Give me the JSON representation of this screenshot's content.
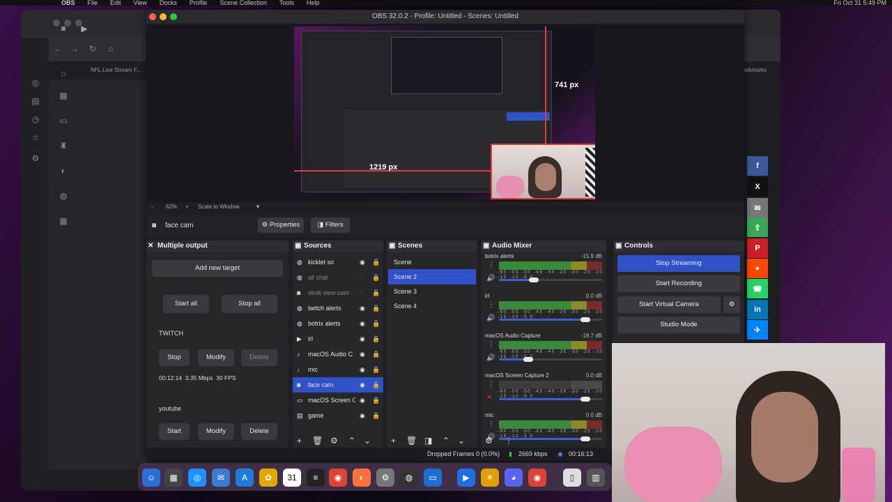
{
  "menubar": {
    "app": "OBS",
    "items": [
      "File",
      "Edit",
      "View",
      "Docks",
      "Profile",
      "Scene Collection",
      "Tools",
      "Help"
    ],
    "clock": "Fri Oct 31 5:49 PM"
  },
  "browser": {
    "tab_title": "NFL Live Stream F...",
    "bookmarks": "Bookmarks"
  },
  "window": {
    "title": "OBS 32.0.2 - Profile: Untitled - Scenes: Untitled"
  },
  "preview": {
    "height_label": "741 px",
    "width_label": "1219 px",
    "zoom": "62%",
    "scale_mode": "Scale to Window"
  },
  "source_toolbar": {
    "selected_source": "face cam",
    "properties": "Properties",
    "filters": "Filters"
  },
  "multiple_output": {
    "title": "Multiple output",
    "add_target": "Add new target",
    "start_all": "Start all",
    "stop_all": "Stop all",
    "targets": [
      {
        "name": "TWITCH",
        "primary": "Stop",
        "modify": "Modify",
        "delete": "Delete",
        "stats": "00:12:14  3.35 Mbps  30 FPS"
      },
      {
        "name": "youtube",
        "primary": "Start",
        "modify": "Modify",
        "delete": "Delete"
      }
    ]
  },
  "sources": {
    "title": "Sources",
    "items": [
      {
        "label": "kicklet so",
        "icon": "globe-icon",
        "dim": false
      },
      {
        "label": "all chat",
        "icon": "globe-icon",
        "dim": true
      },
      {
        "label": "desk view cam",
        "icon": "camera-icon",
        "dim": true
      },
      {
        "label": "twitch alerts",
        "icon": "globe-icon",
        "dim": false
      },
      {
        "label": "botrix alerts",
        "icon": "globe-icon",
        "dim": false
      },
      {
        "label": "irl",
        "icon": "play-icon",
        "dim": false
      },
      {
        "label": "macOS Audio C",
        "icon": "speaker-icon",
        "dim": false
      },
      {
        "label": "mic",
        "icon": "mic-icon",
        "dim": false
      },
      {
        "label": "face cam",
        "icon": "camera-icon",
        "dim": false,
        "selected": true
      },
      {
        "label": "macOS Screen C",
        "icon": "monitor-icon",
        "dim": false
      },
      {
        "label": "game",
        "icon": "window-icon",
        "dim": false
      }
    ]
  },
  "scenes": {
    "title": "Scenes",
    "items": [
      {
        "label": "Scene"
      },
      {
        "label": "Scene 2",
        "selected": true
      },
      {
        "label": "Scene 3"
      },
      {
        "label": "Scene 4"
      }
    ]
  },
  "audio_mixer": {
    "title": "Audio Mixer",
    "scale": "-60 -55 -50 -45 -40 -35 -30 -25 -20 -15 -10 -5 0",
    "channels": [
      {
        "name": "botrix alerts",
        "db": "-15.9 dB",
        "volume": 0.45,
        "active": true
      },
      {
        "name": "irl",
        "db": "0.0 dB",
        "volume": 0.95,
        "active": true
      },
      {
        "name": "macOS Audio Capture",
        "db": "-18.7 dB",
        "volume": 0.4,
        "active": true
      },
      {
        "name": "macOS Screen Capture 2",
        "db": "0.0 dB",
        "volume": 0.95,
        "active": false,
        "muted": true
      },
      {
        "name": "mic",
        "db": "0.0 dB",
        "volume": 0.95,
        "active": true
      }
    ]
  },
  "controls": {
    "title": "Controls",
    "stop_streaming": "Stop Streaming",
    "start_recording": "Start Recording",
    "start_virtual_camera": "Start Virtual Camera",
    "studio_mode": "Studio Mode"
  },
  "status": {
    "dropped_frames": "Dropped Frames 0 (0.0%)",
    "bitrate": "2669 kbps",
    "time": "00:16:13"
  },
  "colors": {
    "accent": "#2f52c9",
    "record_red": "#e23b3b"
  }
}
